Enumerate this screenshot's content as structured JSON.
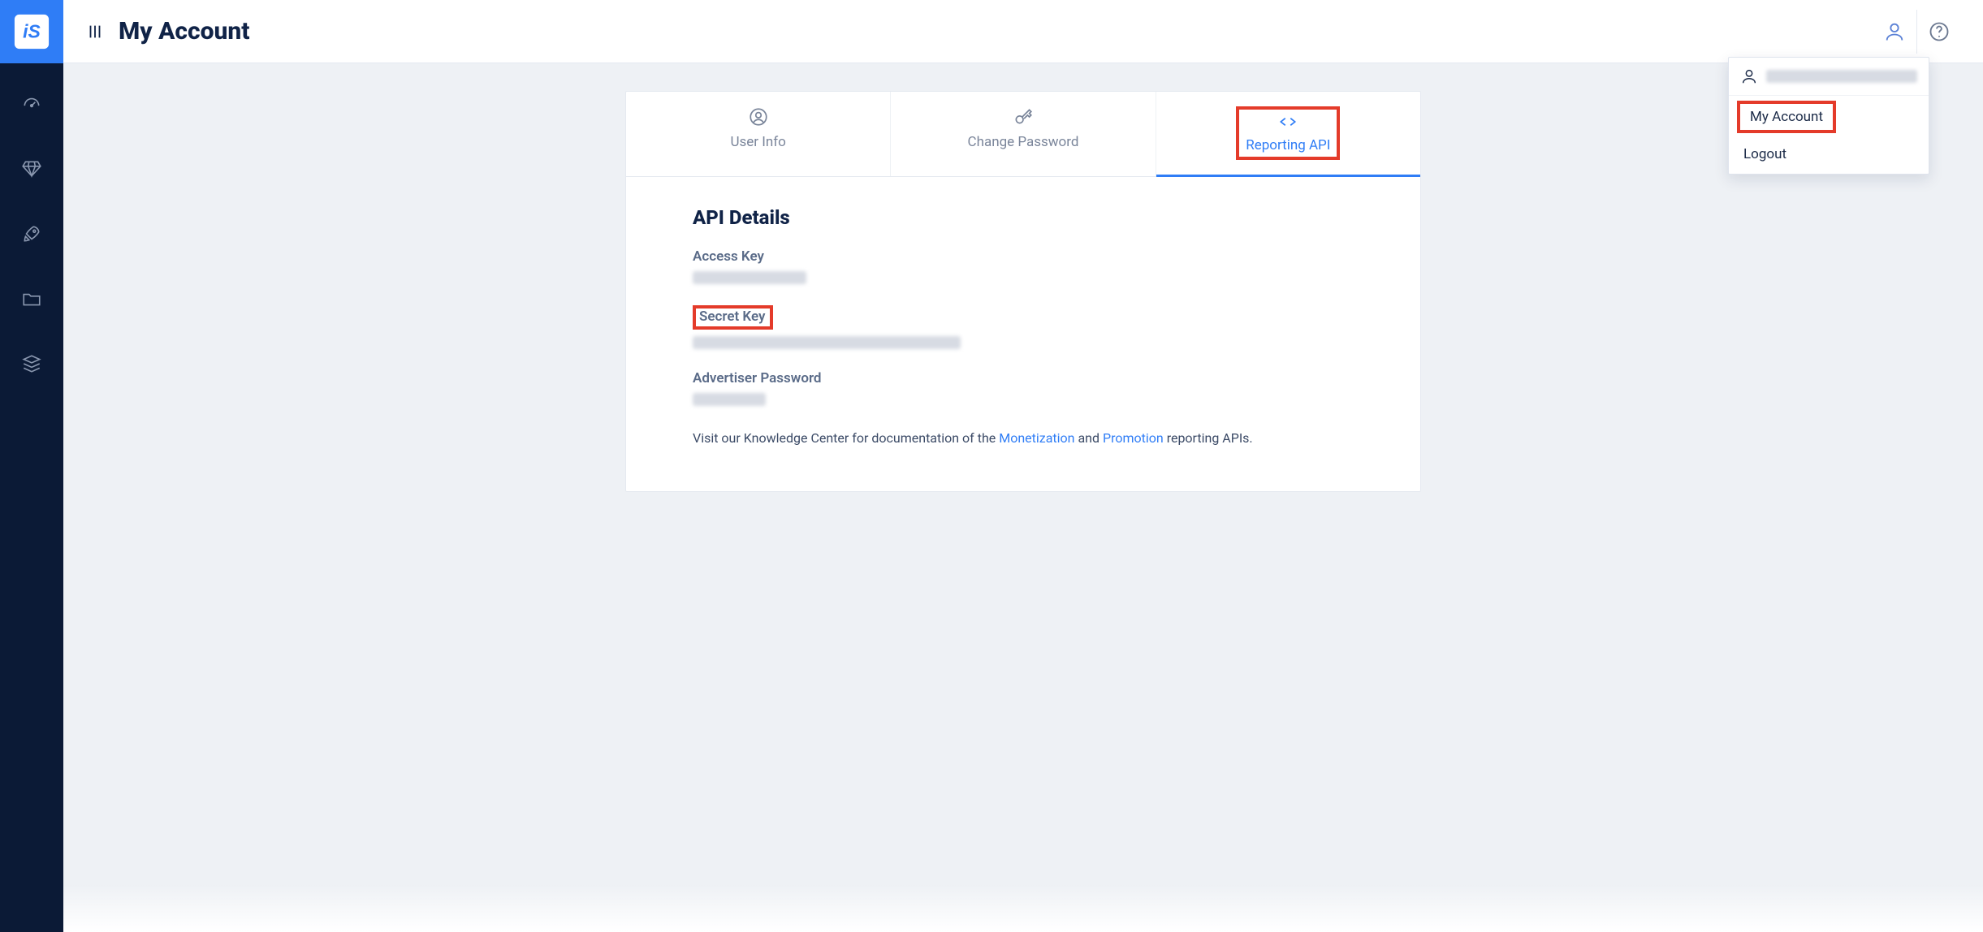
{
  "header": {
    "title": "My Account"
  },
  "dropdown": {
    "my_account": "My Account",
    "logout": "Logout"
  },
  "tabs": {
    "user_info": "User Info",
    "change_password": "Change Password",
    "reporting_api": "Reporting API"
  },
  "api_panel": {
    "heading": "API Details",
    "access_key_label": "Access Key",
    "secret_key_label": "Secret Key",
    "advertiser_password_label": "Advertiser Password",
    "footnote_prefix": "Visit our Knowledge Center for documentation of the ",
    "footnote_link_monetization": "Monetization",
    "footnote_mid": " and ",
    "footnote_link_promotion": "Promotion",
    "footnote_suffix": " reporting APIs."
  },
  "colors": {
    "brand_blue": "#2f7df6",
    "rail_bg": "#0b1a36",
    "highlight_red": "#e43b2a"
  }
}
